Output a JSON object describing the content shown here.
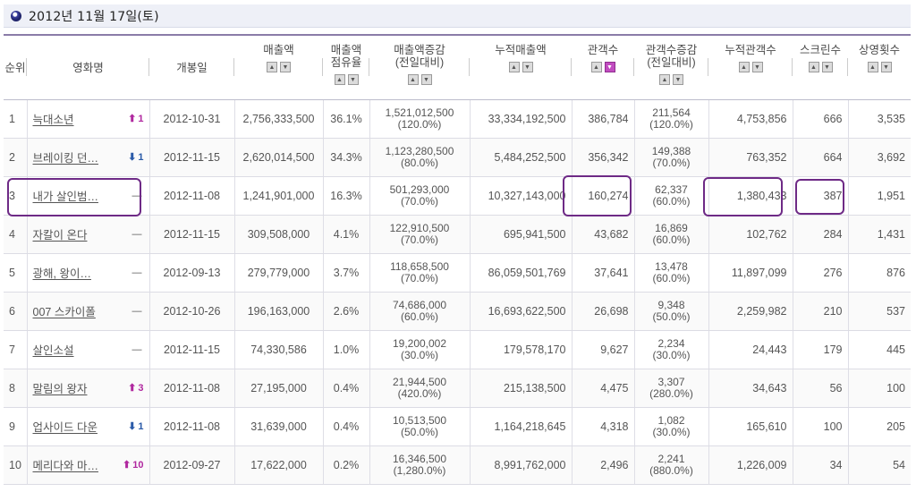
{
  "header": {
    "date": "2012년 11월 17일(토)"
  },
  "columns": [
    {
      "label": "순위",
      "sort": false
    },
    {
      "label": "영화명",
      "sort": false
    },
    {
      "label": "개봉일",
      "sort": false
    },
    {
      "label": "매출액",
      "sort": true
    },
    {
      "label": "매출액\n점유율",
      "sort": true
    },
    {
      "label": "매출액증감\n(전일대비)",
      "sort": true
    },
    {
      "label": "누적매출액",
      "sort": true
    },
    {
      "label": "관객수",
      "sort": true,
      "active": true
    },
    {
      "label": "관객수증감\n(전일대비)",
      "sort": true
    },
    {
      "label": "누적관객수",
      "sort": true
    },
    {
      "label": "스크린수",
      "sort": true
    },
    {
      "label": "상영횟수",
      "sort": true
    }
  ],
  "rows": [
    {
      "rank": "1",
      "title": "늑대소년",
      "change_dir": "up",
      "change": "1",
      "release": "2012-10-31",
      "sales": "2,756,333,500",
      "share": "36.1%",
      "sales_diff": "1,521,012,500",
      "sales_diff_pct": "(120.0%)",
      "cum_sales": "33,334,192,500",
      "audience": "386,784",
      "aud_diff": "211,564",
      "aud_diff_pct": "(120.0%)",
      "cum_aud": "4,753,856",
      "screens": "666",
      "shows": "3,535"
    },
    {
      "rank": "2",
      "title": "브레이킹 던…",
      "change_dir": "down",
      "change": "1",
      "release": "2012-11-15",
      "sales": "2,620,014,500",
      "share": "34.3%",
      "sales_diff": "1,123,280,500",
      "sales_diff_pct": "(80.0%)",
      "cum_sales": "5,484,252,500",
      "audience": "356,342",
      "aud_diff": "149,388",
      "aud_diff_pct": "(70.0%)",
      "cum_aud": "763,352",
      "screens": "664",
      "shows": "3,692"
    },
    {
      "rank": "3",
      "title": "내가 살인범…",
      "change_dir": "same",
      "change": "",
      "release": "2012-11-08",
      "sales": "1,241,901,000",
      "share": "16.3%",
      "sales_diff": "501,293,000",
      "sales_diff_pct": "(70.0%)",
      "cum_sales": "10,327,143,000",
      "audience": "160,274",
      "aud_diff": "62,337",
      "aud_diff_pct": "(60.0%)",
      "cum_aud": "1,380,433",
      "screens": "387",
      "shows": "1,951"
    },
    {
      "rank": "4",
      "title": "자칼이 온다",
      "change_dir": "same",
      "change": "",
      "release": "2012-11-15",
      "sales": "309,508,000",
      "share": "4.1%",
      "sales_diff": "122,910,500",
      "sales_diff_pct": "(70.0%)",
      "cum_sales": "695,941,500",
      "audience": "43,682",
      "aud_diff": "16,869",
      "aud_diff_pct": "(60.0%)",
      "cum_aud": "102,762",
      "screens": "284",
      "shows": "1,431"
    },
    {
      "rank": "5",
      "title": "광해, 왕이…",
      "change_dir": "same",
      "change": "",
      "release": "2012-09-13",
      "sales": "279,779,000",
      "share": "3.7%",
      "sales_diff": "118,658,500",
      "sales_diff_pct": "(70.0%)",
      "cum_sales": "86,059,501,769",
      "audience": "37,641",
      "aud_diff": "13,478",
      "aud_diff_pct": "(60.0%)",
      "cum_aud": "11,897,099",
      "screens": "276",
      "shows": "876"
    },
    {
      "rank": "6",
      "title": "007 스카이폴",
      "change_dir": "same",
      "change": "",
      "release": "2012-10-26",
      "sales": "196,163,000",
      "share": "2.6%",
      "sales_diff": "74,686,000",
      "sales_diff_pct": "(60.0%)",
      "cum_sales": "16,693,622,500",
      "audience": "26,698",
      "aud_diff": "9,348",
      "aud_diff_pct": "(50.0%)",
      "cum_aud": "2,259,982",
      "screens": "210",
      "shows": "537"
    },
    {
      "rank": "7",
      "title": "살인소설",
      "change_dir": "same",
      "change": "",
      "release": "2012-11-15",
      "sales": "74,330,586",
      "share": "1.0%",
      "sales_diff": "19,200,002",
      "sales_diff_pct": "(30.0%)",
      "cum_sales": "179,578,170",
      "audience": "9,627",
      "aud_diff": "2,234",
      "aud_diff_pct": "(30.0%)",
      "cum_aud": "24,443",
      "screens": "179",
      "shows": "445"
    },
    {
      "rank": "8",
      "title": "말림의 왕자",
      "change_dir": "up",
      "change": "3",
      "release": "2012-11-08",
      "sales": "27,195,000",
      "share": "0.4%",
      "sales_diff": "21,944,500",
      "sales_diff_pct": "(420.0%)",
      "cum_sales": "215,138,500",
      "audience": "4,475",
      "aud_diff": "3,307",
      "aud_diff_pct": "(280.0%)",
      "cum_aud": "34,643",
      "screens": "56",
      "shows": "100"
    },
    {
      "rank": "9",
      "title": "업사이드 다운",
      "change_dir": "down",
      "change": "1",
      "release": "2012-11-08",
      "sales": "31,639,000",
      "share": "0.4%",
      "sales_diff": "10,513,500",
      "sales_diff_pct": "(50.0%)",
      "cum_sales": "1,164,218,645",
      "audience": "4,318",
      "aud_diff": "1,082",
      "aud_diff_pct": "(30.0%)",
      "cum_aud": "165,610",
      "screens": "100",
      "shows": "205"
    },
    {
      "rank": "10",
      "title": "메리다와 마…",
      "change_dir": "up",
      "change": "10",
      "release": "2012-09-27",
      "sales": "17,622,000",
      "share": "0.2%",
      "sales_diff": "16,346,500",
      "sales_diff_pct": "(1,280.0%)",
      "cum_sales": "8,991,762,000",
      "audience": "2,496",
      "aud_diff": "2,241",
      "aud_diff_pct": "(880.0%)",
      "cum_aud": "1,226,009",
      "screens": "34",
      "shows": "54"
    }
  ],
  "colors": {
    "highlight": "#6e2a86",
    "rank_up": "#b0289f",
    "rank_down": "#2a5aa8"
  }
}
